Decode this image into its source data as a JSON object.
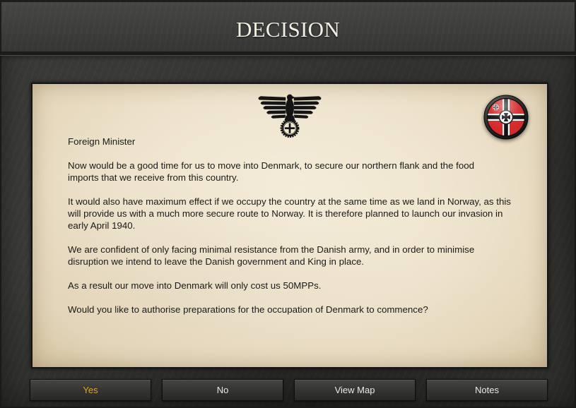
{
  "dialog": {
    "title": "DECISION"
  },
  "emblem": {
    "icon": "eagle-wreath-emblem-icon"
  },
  "badge": {
    "icon": "war-flag-badge-icon",
    "colors": {
      "field": "#d42a2b",
      "cross": "#111111",
      "fimbriation": "#ffffff"
    }
  },
  "message": {
    "salutation": "Foreign Minister",
    "paragraphs": [
      [
        "Now would be a good time for us to move into Denmark, to secure our northern flank and the food",
        "imports that we receive from this country."
      ],
      [
        "It would also have maximum effect if we occupy the country at the same time as we land in Norway, as this",
        "will provide us with a much more secure route to Norway. It is therefore planned to launch our invasion in",
        "early April 1940."
      ],
      [
        "We are confident of only facing minimal resistance from the Danish army, and in order to minimise",
        "disruption we intend to leave the Danish government and King in place."
      ],
      [
        "As a result our move into Denmark will only cost us 50MPPs."
      ],
      [
        "Would you like to authorise preparations for the occupation of Denmark to commence?"
      ]
    ]
  },
  "buttons": [
    {
      "label": "Yes",
      "highlighted": true
    },
    {
      "label": "No",
      "highlighted": false
    },
    {
      "label": "View Map",
      "highlighted": false
    },
    {
      "label": "Notes",
      "highlighted": false
    }
  ],
  "theme": {
    "accent": "#d8a72b",
    "button_text": "#e8e8e6",
    "parchment": "#efe5cf",
    "frame": "#363634"
  }
}
